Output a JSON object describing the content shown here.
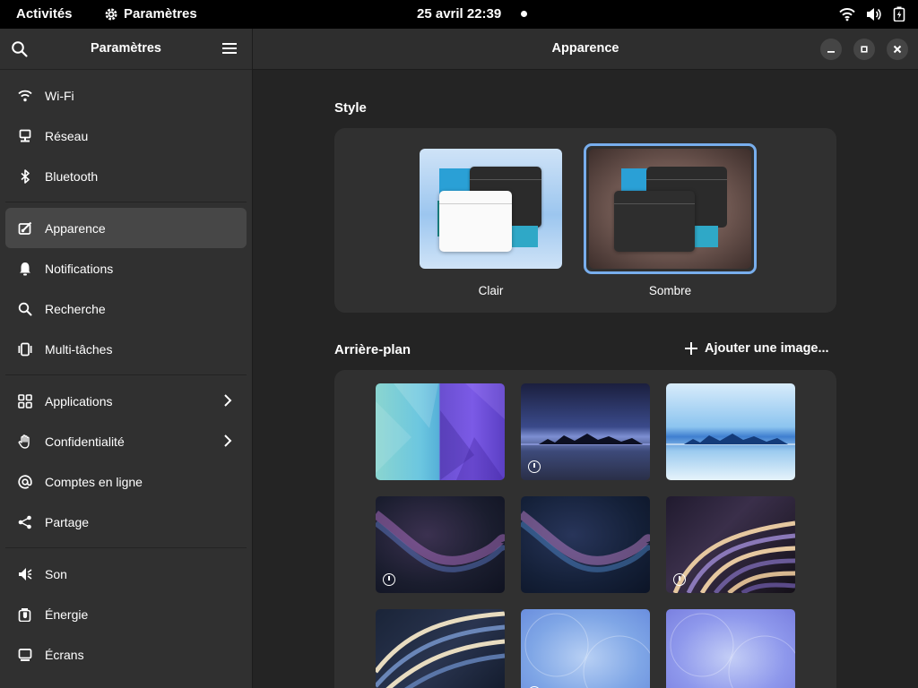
{
  "topbar": {
    "activities": "Activités",
    "app_name": "Paramètres",
    "clock": "25 avril  22:39"
  },
  "sidebar": {
    "title": "Paramètres",
    "items": [
      {
        "label": "Wi-Fi",
        "icon": "wifi-icon"
      },
      {
        "label": "Réseau",
        "icon": "network-icon"
      },
      {
        "label": "Bluetooth",
        "icon": "bluetooth-icon"
      },
      {
        "label": "Apparence",
        "icon": "appearance-icon",
        "active": true
      },
      {
        "label": "Notifications",
        "icon": "bell-icon"
      },
      {
        "label": "Recherche",
        "icon": "search-icon"
      },
      {
        "label": "Multi-tâches",
        "icon": "multitasking-icon"
      },
      {
        "label": "Applications",
        "icon": "apps-icon"
      },
      {
        "label": "Confidentialité",
        "icon": "hand-icon"
      },
      {
        "label": "Comptes en ligne",
        "icon": "at-icon"
      },
      {
        "label": "Partage",
        "icon": "share-icon"
      },
      {
        "label": "Son",
        "icon": "speaker-icon"
      },
      {
        "label": "Énergie",
        "icon": "power-icon"
      },
      {
        "label": "Écrans",
        "icon": "display-icon"
      }
    ]
  },
  "main": {
    "title": "Apparence",
    "style_section": "Style",
    "style_options": [
      {
        "label": "Clair",
        "selected": false
      },
      {
        "label": "Sombre",
        "selected": true
      }
    ],
    "background_section": "Arrière-plan",
    "add_image": "Ajouter une image..."
  },
  "colors": {
    "accent": "#78aeed",
    "sidebar_bg": "#303030",
    "main_bg": "#242424",
    "card_bg": "#303030"
  }
}
